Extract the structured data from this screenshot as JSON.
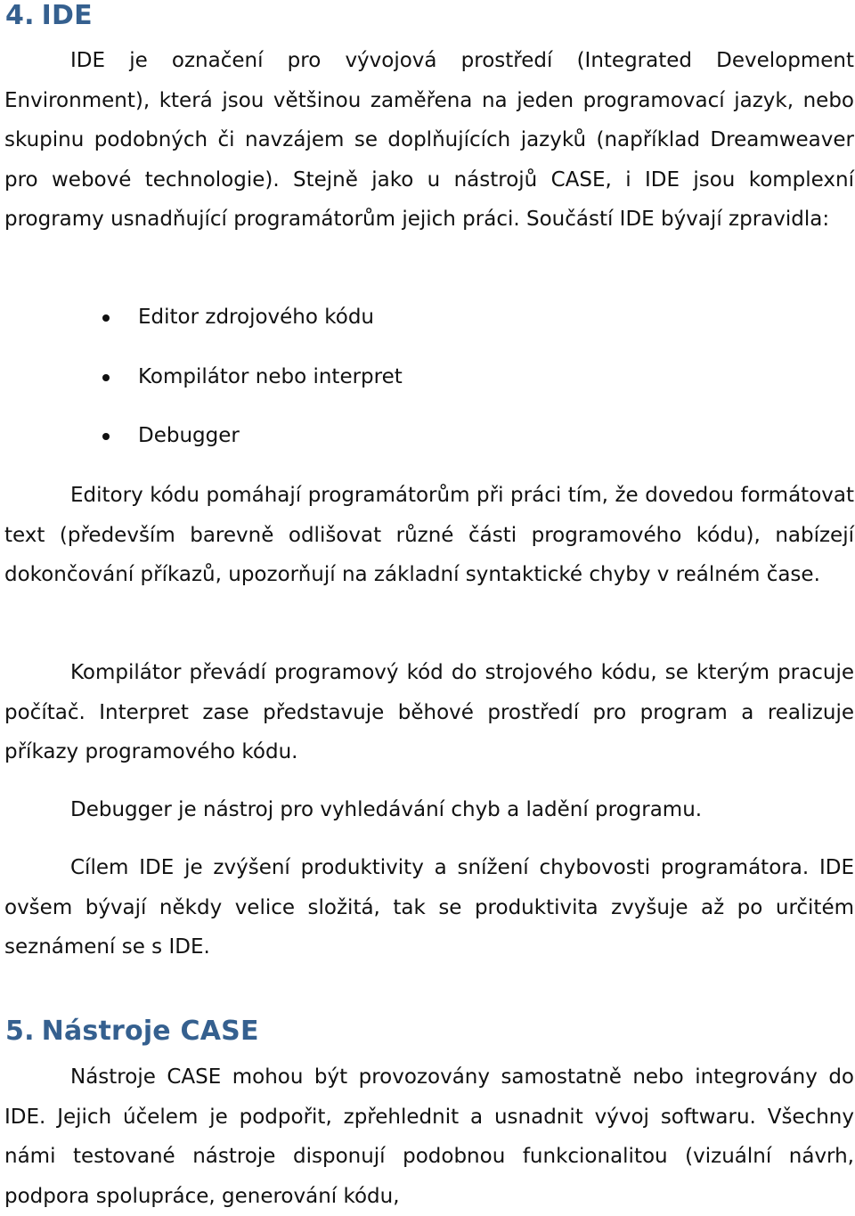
{
  "sections": [
    {
      "number": "4.",
      "title": "IDE",
      "intro": "IDE je označení pro vývojová prostředí (Integrated Development Environment), která jsou většinou zaměřena na jeden programovací jazyk, nebo skupinu podobných či navzájem se doplňujících jazyků (například Dreamweaver pro webové technologie). Stejně jako u nástrojů CASE, i IDE jsou komplexní programy usnadňující programátorům jejich práci. Součástí IDE bývají zpravidla:",
      "bullets": [
        "Editor zdrojového kódu",
        "Kompilátor nebo interpret",
        "Debugger"
      ],
      "paragraphs": [
        "Editory kódu pomáhají programátorům při práci tím, že dovedou formátovat text (především barevně odlišovat různé části programového kódu), nabízejí dokončování příkazů, upozorňují na základní syntaktické chyby v reálném čase.",
        "Kompilátor převádí programový kód do strojového kódu, se kterým pracuje počítač. Interpret zase představuje běhové prostředí pro program a realizuje příkazy programového kódu.",
        "Debugger je nástroj pro vyhledávání chyb a ladění programu.",
        "Cílem IDE je zvýšení produktivity a snížení chybovosti programátora. IDE ovšem bývají někdy velice složitá, tak se produktivita zvyšuje až po určitém seznámení se s IDE."
      ]
    },
    {
      "number": "5.",
      "title": "Nástroje CASE",
      "paragraphs": [
        "Nástroje CASE mohou být provozovány samostatně nebo integrovány do IDE. Jejich účelem je podpořit, zpřehlednit a usnadnit vývoj softwaru.  Všechny námi testované nástroje disponují podobnou funkcionalitou (vizuální návrh, podpora spolupráce, generování kódu,"
      ]
    }
  ],
  "colors": {
    "heading": "#35608f",
    "text": "#111111",
    "background": "#ffffff"
  }
}
